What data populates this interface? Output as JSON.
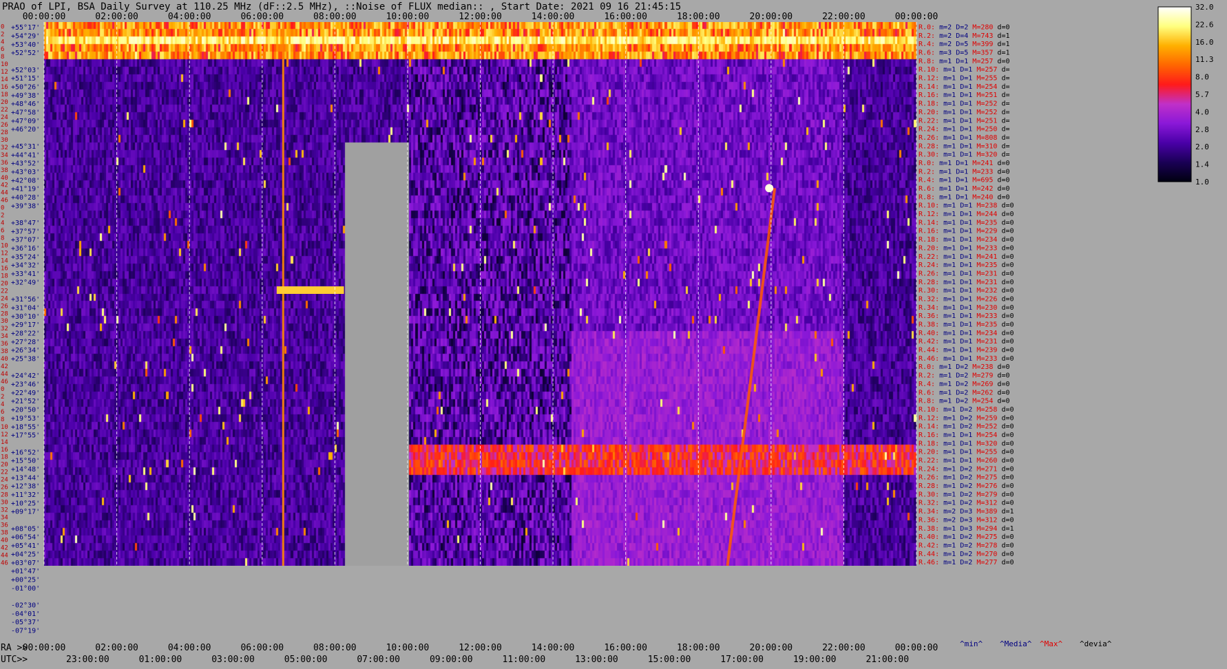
{
  "title": "PRAO of LPI, BSA Daily Survey at 110.25 MHz (dF::2.5 MHz), ::Noise_of_FLUX_median:: , Start Date: 2021 09 16 21:45:15",
  "chart_data": {
    "type": "heatmap",
    "title": "PRAO of LPI, BSA Daily Survey at 110.25 MHz (dF::2.5 MHz), ::Noise_of_FLUX_median:: , Start Date: 2021 09 16 21:45:15",
    "x_top_ticks": [
      "00:00:00",
      "02:00:00",
      "04:00:00",
      "06:00:00",
      "08:00:00",
      "10:00:00",
      "12:00:00",
      "14:00:00",
      "16:00:00",
      "18:00:00",
      "20:00:00",
      "22:00:00",
      "00:00:00"
    ],
    "x_bottom_ra_prefix": "RA >>",
    "x_bottom_ra_ticks": [
      "00:00:00",
      "02:00:00",
      "04:00:00",
      "06:00:00",
      "08:00:00",
      "10:00:00",
      "12:00:00",
      "14:00:00",
      "16:00:00",
      "18:00:00",
      "20:00:00",
      "22:00:00",
      "00:00:00"
    ],
    "x_bottom_utc_prefix": "UTC>>",
    "x_bottom_utc_ticks": [
      "23:00:00",
      "01:00:00",
      "03:00:00",
      "05:00:00",
      "07:00:00",
      "09:00:00",
      "11:00:00",
      "13:00:00",
      "15:00:00",
      "17:00:00",
      "19:00:00",
      "21:00:00"
    ],
    "declinations": [
      "+55°17'",
      "+54°29'",
      "+53°40'",
      "+52°52'",
      "+52°03'",
      "+51°15'",
      "+50°26'",
      "+49°38'",
      "+48°46'",
      "+47°58'",
      "+47°09'",
      "+46°20'",
      "+45°31'",
      "+44°41'",
      "+43°52'",
      "+43°03'",
      "+42°08'",
      "+41°19'",
      "+40°28'",
      "+39°38'",
      "+38°47'",
      "+37°57'",
      "+37°07'",
      "+36°16'",
      "+35°24'",
      "+34°32'",
      "+33°41'",
      "+32°49'",
      "+31°56'",
      "+31°04'",
      "+30°10'",
      "+29°17'",
      "+28°22'",
      "+27°28'",
      "+26°34'",
      "+25°38'",
      "+24°42'",
      "+23°46'",
      "+22°49'",
      "+21°52'",
      "+20°50'",
      "+19°53'",
      "+18°55'",
      "+17°55'",
      "+16°52'",
      "+15°50'",
      "+14°48'",
      "+13°44'",
      "+12°38'",
      "+11°32'",
      "+10°25'",
      "+09°17'",
      "+08°05'",
      "+06°54'",
      "+05°41'",
      "+04°25'",
      "+03°07'",
      "+01°47'",
      "+00°25'",
      "-01°00'",
      "-02°30'",
      "-04°01'",
      "-05°37'",
      "-07°19'"
    ],
    "beam_numbers": [
      "0",
      "2",
      "4",
      "6",
      "8",
      "10",
      "12",
      "14",
      "16",
      "18",
      "20",
      "22",
      "24",
      "26",
      "28",
      "30",
      "32",
      "34",
      "36",
      "38",
      "40",
      "42",
      "44",
      "46",
      "0",
      "2",
      "4",
      "6",
      "8",
      "10",
      "12",
      "14",
      "16",
      "18",
      "20",
      "22",
      "24",
      "26",
      "28",
      "30",
      "32",
      "34",
      "36",
      "38",
      "40",
      "42",
      "44",
      "46",
      "0",
      "2",
      "4",
      "6",
      "8",
      "10",
      "12",
      "14",
      "16",
      "18",
      "20",
      "22",
      "24",
      "26",
      "28",
      "30",
      "32",
      "34",
      "36",
      "38",
      "40",
      "42",
      "44",
      "46"
    ],
    "row_stats": [
      {
        "label": "R.0:",
        "m": "2",
        "D": "2",
        "M": "280",
        "d": "0"
      },
      {
        "label": "R.2:",
        "m": "2",
        "D": "4",
        "M": "743",
        "d": "1"
      },
      {
        "label": "R.4:",
        "m": "2",
        "D": "5",
        "M": "399",
        "d": "1"
      },
      {
        "label": "R.6:",
        "m": "3",
        "D": "5",
        "M": "357",
        "d": "1"
      },
      {
        "label": "R.8:",
        "m": "1",
        "D": "1",
        "M": "257",
        "d": "0"
      },
      {
        "label": "R.10:",
        "m": "1",
        "D": "1",
        "M": "257",
        "d": ""
      },
      {
        "label": "R.12:",
        "m": "1",
        "D": "1",
        "M": "255",
        "d": ""
      },
      {
        "label": "R.14:",
        "m": "1",
        "D": "1",
        "M": "254",
        "d": ""
      },
      {
        "label": "R.16:",
        "m": "1",
        "D": "1",
        "M": "251",
        "d": ""
      },
      {
        "label": "R.18:",
        "m": "1",
        "D": "1",
        "M": "252",
        "d": ""
      },
      {
        "label": "R.20:",
        "m": "1",
        "D": "1",
        "M": "252",
        "d": ""
      },
      {
        "label": "R.22:",
        "m": "1",
        "D": "1",
        "M": "251",
        "d": ""
      },
      {
        "label": "R.24:",
        "m": "1",
        "D": "1",
        "M": "250",
        "d": ""
      },
      {
        "label": "R.26:",
        "m": "1",
        "D": "1",
        "M": "808",
        "d": ""
      },
      {
        "label": "R.28:",
        "m": "1",
        "D": "1",
        "M": "310",
        "d": ""
      },
      {
        "label": "R.30:",
        "m": "1",
        "D": "1",
        "M": "320",
        "d": ""
      },
      {
        "label": "R.0:",
        "m": "1",
        "D": "1",
        "M": "241",
        "d": "0"
      },
      {
        "label": "R.2:",
        "m": "1",
        "D": "1",
        "M": "233",
        "d": "0"
      },
      {
        "label": "R.4:",
        "m": "1",
        "D": "1",
        "M": "695",
        "d": "0"
      },
      {
        "label": "R.6:",
        "m": "1",
        "D": "1",
        "M": "242",
        "d": "0"
      },
      {
        "label": "R.8:",
        "m": "1",
        "D": "1",
        "M": "240",
        "d": "0"
      },
      {
        "label": "R.10:",
        "m": "1",
        "D": "1",
        "M": "238",
        "d": "0"
      },
      {
        "label": "R.12:",
        "m": "1",
        "D": "1",
        "M": "244",
        "d": "0"
      },
      {
        "label": "R.14:",
        "m": "1",
        "D": "1",
        "M": "235",
        "d": "0"
      },
      {
        "label": "R.16:",
        "m": "1",
        "D": "1",
        "M": "229",
        "d": "0"
      },
      {
        "label": "R.18:",
        "m": "1",
        "D": "1",
        "M": "234",
        "d": "0"
      },
      {
        "label": "R.20:",
        "m": "1",
        "D": "1",
        "M": "233",
        "d": "0"
      },
      {
        "label": "R.22:",
        "m": "1",
        "D": "1",
        "M": "241",
        "d": "0"
      },
      {
        "label": "R.24:",
        "m": "1",
        "D": "1",
        "M": "235",
        "d": "0"
      },
      {
        "label": "R.26:",
        "m": "1",
        "D": "1",
        "M": "231",
        "d": "0"
      },
      {
        "label": "R.28:",
        "m": "1",
        "D": "1",
        "M": "231",
        "d": "0"
      },
      {
        "label": "R.30:",
        "m": "1",
        "D": "1",
        "M": "232",
        "d": "0"
      },
      {
        "label": "R.32:",
        "m": "1",
        "D": "1",
        "M": "226",
        "d": "0"
      },
      {
        "label": "R.34:",
        "m": "1",
        "D": "1",
        "M": "230",
        "d": "0"
      },
      {
        "label": "R.36:",
        "m": "1",
        "D": "1",
        "M": "233",
        "d": "0"
      },
      {
        "label": "R.38:",
        "m": "1",
        "D": "1",
        "M": "235",
        "d": "0"
      },
      {
        "label": "R.40:",
        "m": "1",
        "D": "1",
        "M": "234",
        "d": "0"
      },
      {
        "label": "R.42:",
        "m": "1",
        "D": "1",
        "M": "231",
        "d": "0"
      },
      {
        "label": "R.44:",
        "m": "1",
        "D": "1",
        "M": "239",
        "d": "0"
      },
      {
        "label": "R.46:",
        "m": "1",
        "D": "1",
        "M": "233",
        "d": "0"
      },
      {
        "label": "R.0:",
        "m": "1",
        "D": "2",
        "M": "238",
        "d": "0"
      },
      {
        "label": "R.2:",
        "m": "1",
        "D": "2",
        "M": "279",
        "d": "0"
      },
      {
        "label": "R.4:",
        "m": "1",
        "D": "2",
        "M": "269",
        "d": "0"
      },
      {
        "label": "R.6:",
        "m": "1",
        "D": "2",
        "M": "262",
        "d": "0"
      },
      {
        "label": "R.8:",
        "m": "1",
        "D": "2",
        "M": "254",
        "d": "0"
      },
      {
        "label": "R.10:",
        "m": "1",
        "D": "2",
        "M": "258",
        "d": "0"
      },
      {
        "label": "R.12:",
        "m": "1",
        "D": "2",
        "M": "259",
        "d": "0"
      },
      {
        "label": "R.14:",
        "m": "1",
        "D": "2",
        "M": "252",
        "d": "0"
      },
      {
        "label": "R.16:",
        "m": "1",
        "D": "1",
        "M": "254",
        "d": "0"
      },
      {
        "label": "R.18:",
        "m": "1",
        "D": "1",
        "M": "320",
        "d": "0"
      },
      {
        "label": "R.20:",
        "m": "1",
        "D": "1",
        "M": "255",
        "d": "0"
      },
      {
        "label": "R.22:",
        "m": "1",
        "D": "1",
        "M": "260",
        "d": "0"
      },
      {
        "label": "R.24:",
        "m": "1",
        "D": "2",
        "M": "271",
        "d": "0"
      },
      {
        "label": "R.26:",
        "m": "1",
        "D": "2",
        "M": "275",
        "d": "0"
      },
      {
        "label": "R.28:",
        "m": "1",
        "D": "2",
        "M": "276",
        "d": "0"
      },
      {
        "label": "R.30:",
        "m": "1",
        "D": "2",
        "M": "279",
        "d": "0"
      },
      {
        "label": "R.32:",
        "m": "1",
        "D": "2",
        "M": "312",
        "d": "0"
      },
      {
        "label": "R.34:",
        "m": "2",
        "D": "3",
        "M": "389",
        "d": "1"
      },
      {
        "label": "R.36:",
        "m": "2",
        "D": "3",
        "M": "312",
        "d": "0"
      },
      {
        "label": "R.38:",
        "m": "1",
        "D": "3",
        "M": "294",
        "d": "1"
      },
      {
        "label": "R.40:",
        "m": "1",
        "D": "2",
        "M": "275",
        "d": "0"
      },
      {
        "label": "R.42:",
        "m": "1",
        "D": "2",
        "M": "278",
        "d": "0"
      },
      {
        "label": "R.44:",
        "m": "1",
        "D": "2",
        "M": "270",
        "d": "0"
      },
      {
        "label": "R.46:",
        "m": "1",
        "D": "2",
        "M": "277",
        "d": "0"
      }
    ],
    "stat_field_names": {
      "m": "m=",
      "D": "D=",
      "M": "M=",
      "d": "d="
    },
    "stat_footer": [
      "^min^",
      "^Media^",
      "^Max^",
      "^devia^"
    ],
    "stat_footer_colors": [
      "#000080",
      "#000080",
      "#e00000",
      "#000000"
    ],
    "colorbar_ticks": [
      "32.0",
      "22.6",
      "16.0",
      "11.3",
      "8.0",
      "5.7",
      "4.0",
      "2.8",
      "2.0",
      "1.4",
      "1.0"
    ],
    "colorbar_min": 1.0,
    "colorbar_max": 32.0,
    "colorbar_scale": "log",
    "colormap_stops": [
      "#000010",
      "#1a0055",
      "#4a00a8",
      "#8a18d8",
      "#c030c8",
      "#ff1a1a",
      "#ff6600",
      "#ffb000",
      "#ffff80",
      "#ffffff"
    ],
    "data_gap_color": "#a0a0a0",
    "label_colors": {
      "axis_text": "#000000",
      "beam_number": "#c00000",
      "dec_label": "#000080",
      "stat_label": "#e00000",
      "stat_value": "#000080"
    }
  }
}
